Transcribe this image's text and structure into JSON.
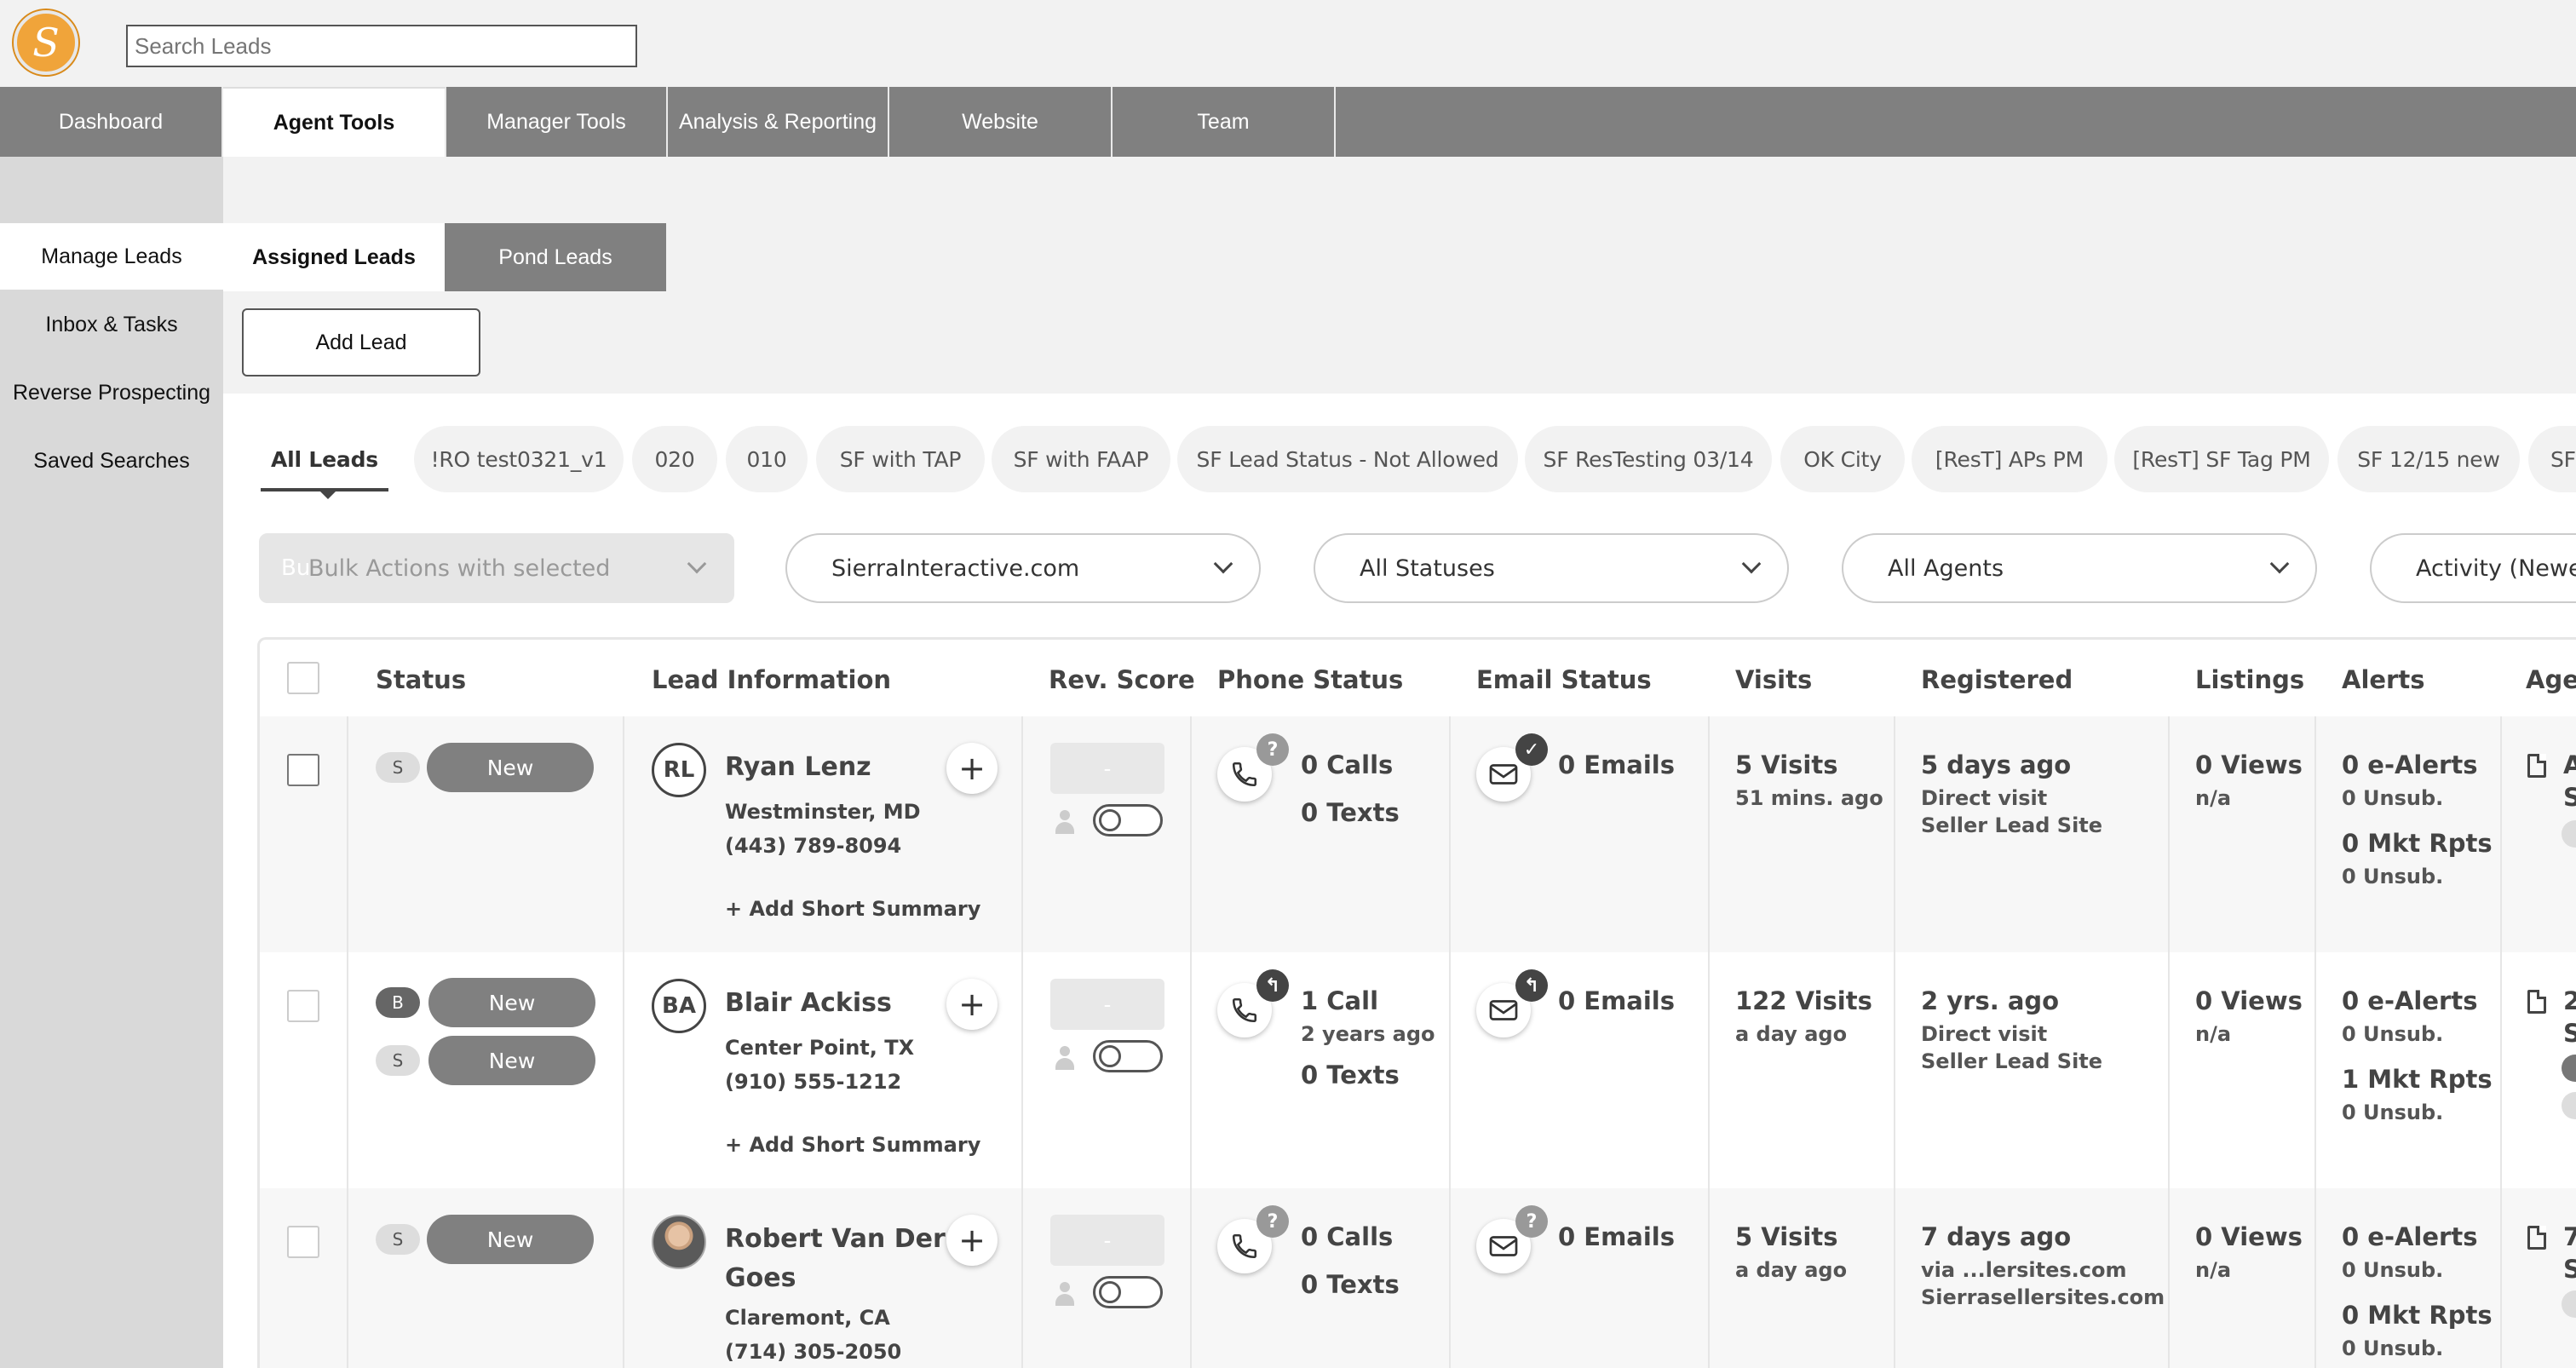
{
  "header": {
    "logo_letter": "S",
    "search_placeholder": "Search Leads"
  },
  "main_nav": [
    "Dashboard",
    "Agent Tools",
    "Manager Tools",
    "Analysis & Reporting",
    "Website",
    "Team"
  ],
  "sidebar": [
    "Manage Leads",
    "Inbox & Tasks",
    "Reverse Prospecting",
    "Saved Searches"
  ],
  "subtabs": {
    "assigned": "Assigned Leads",
    "pond": "Pond Leads"
  },
  "add_lead": "Add Lead",
  "chips": [
    "All Leads",
    "!RO test0321_v1",
    "020",
    "010",
    "SF with TAP",
    "SF with FAAP",
    "SF Lead Status - Not Allowed",
    "SF ResTesting 03/14",
    "OK City",
    "[ResT] APs PM",
    "[ResT] SF Tag PM",
    "SF 12/15 new",
    "SF"
  ],
  "filters": {
    "bulk": "Bulk Actions with selected",
    "bulk_ghost": "Bu",
    "site": "SierraInteractive.com",
    "status": "All Statuses",
    "agents": "All Agents",
    "sort": "Activity (Newe"
  },
  "columns": [
    "Status",
    "Lead Information",
    "Rev. Score",
    "Phone Status",
    "Email Status",
    "Visits",
    "Registered",
    "Listings",
    "Alerts",
    "Agen"
  ],
  "leads": [
    {
      "badges": [
        "S"
      ],
      "statuses": [
        "New"
      ],
      "initials": "RL",
      "name1": "Ryan Lenz",
      "name2": "",
      "location": "Westminster, MD",
      "phone": "(443) 789-8094",
      "summary": "+ Add Short Summary",
      "score": "-",
      "phone_badge": "?",
      "calls": "0 Calls",
      "calls_sub": "",
      "texts": "0 Texts",
      "email_badge": "✓",
      "emails": "0 Emails",
      "visits": "5 Visits",
      "visits_sub": "51 mins. ago",
      "registered": "5 days ago",
      "reg1": "Direct visit",
      "reg2": "Seller Lead Site",
      "views": "0 Views",
      "views_sub": "n/a",
      "ealerts": "0 e-Alerts",
      "unsub1": "0 Unsub.",
      "mkt": "0 Mkt Rpts",
      "unsub2": "0 Unsub.",
      "agent1": "A",
      "agent2": "S"
    },
    {
      "badges": [
        "B",
        "S"
      ],
      "statuses": [
        "New",
        "New"
      ],
      "initials": "BA",
      "name1": "Blair Ackiss",
      "name2": "",
      "location": "Center Point, TX",
      "phone": "(910) 555-1212",
      "summary": "+ Add Short Summary",
      "score": "-",
      "phone_badge": "↰",
      "calls": "1 Call",
      "calls_sub": "2 years ago",
      "texts": "0 Texts",
      "email_badge": "↰",
      "emails": "0 Emails",
      "visits": "122 Visits",
      "visits_sub": "a day ago",
      "registered": "2 yrs. ago",
      "reg1": "Direct visit",
      "reg2": "Seller Lead Site",
      "views": "0 Views",
      "views_sub": "n/a",
      "ealerts": "0 e-Alerts",
      "unsub1": "0 Unsub.",
      "mkt": "1 Mkt Rpts",
      "unsub2": "0 Unsub.",
      "agent1": "2",
      "agent2": "S"
    },
    {
      "badges": [
        "S"
      ],
      "statuses": [
        "New"
      ],
      "initials": "",
      "name1": "Robert Van Der",
      "name2": "Goes",
      "location": "Claremont, CA",
      "phone": "(714) 305-2050",
      "summary": "",
      "score": "-",
      "phone_badge": "?",
      "calls": "0 Calls",
      "calls_sub": "",
      "texts": "0 Texts",
      "email_badge": "?",
      "emails": "0 Emails",
      "visits": "5 Visits",
      "visits_sub": "a day ago",
      "registered": "7 days ago",
      "reg1": "via ...lersites.com",
      "reg2": "Sierrasellersites.com",
      "views": "0 Views",
      "views_sub": "n/a",
      "ealerts": "0 e-Alerts",
      "unsub1": "0 Unsub.",
      "mkt": "0 Mkt Rpts",
      "unsub2": "0 Unsub.",
      "agent1": "7",
      "agent2": "S"
    }
  ]
}
